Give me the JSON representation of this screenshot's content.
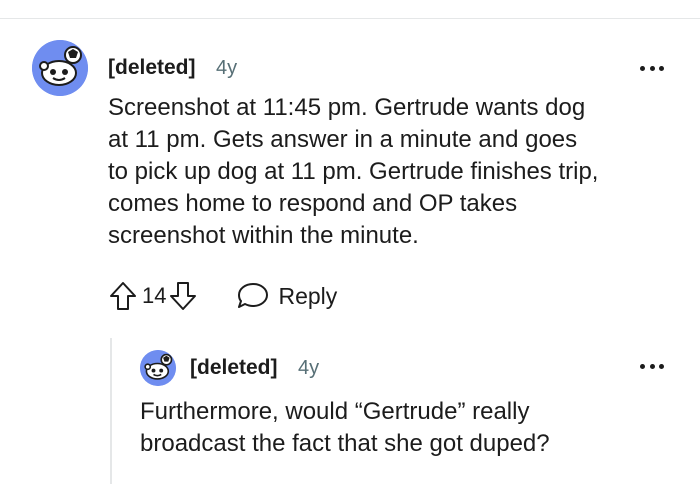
{
  "comment": {
    "author": "[deleted]",
    "age": "4y",
    "body_lines": [
      "Screenshot at 11:45 pm. Gertrude wants dog",
      "at 11 pm. Gets answer in a minute and goes",
      "to pick up dog at 11 pm. Gertrude finishes trip,",
      "comes home to respond and OP takes",
      "screenshot within the minute."
    ],
    "score": "14",
    "reply_label": "Reply",
    "avatar_icon": "snoo-avatar-icon",
    "avatar_color": "#6f8df0"
  },
  "reply": {
    "author": "[deleted]",
    "age": "4y",
    "body_lines": [
      "Furthermore, would “Gertrude” really",
      "broadcast the fact that she got duped?"
    ],
    "avatar_icon": "snoo-avatar-icon"
  },
  "colors": {
    "text": "#1c1c1c",
    "meta": "#576f76",
    "divider": "#e5e7e8"
  }
}
